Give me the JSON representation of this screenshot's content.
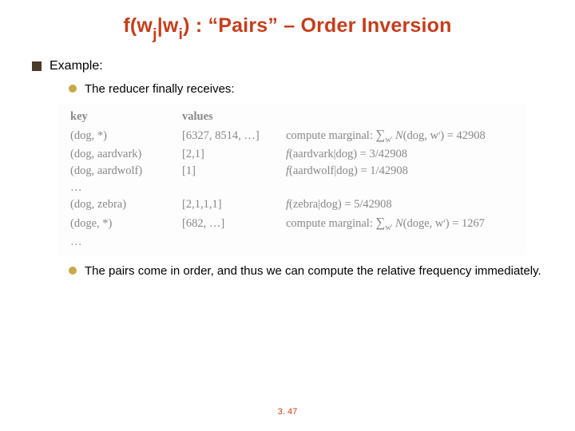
{
  "title": {
    "fw": "f(w",
    "j": "j",
    "bar_w": "|w",
    "i": "i",
    "rest": ") : “Pairs” – Order Inversion"
  },
  "bullets": {
    "example": "Example:",
    "sub1": "The reducer finally receives:",
    "sub2": "The pairs come in order, and thus we can compute the relative frequency immediately."
  },
  "table": {
    "headers": {
      "key": "key",
      "values": "values"
    },
    "rows": [
      {
        "key": "(dog, *)",
        "values": "[6327, 8514, …]",
        "comp": "compute marginal: ∑_{w'} N(dog, w') = 42908"
      },
      {
        "key": "(dog, aardvark)",
        "values": "[2,1]",
        "comp": "f(aardvark|dog) = 3/42908"
      },
      {
        "key": "(dog, aardwolf)",
        "values": "[1]",
        "comp": "f(aardwolf|dog) = 1/42908"
      },
      {
        "key": "…",
        "values": "",
        "comp": ""
      },
      {
        "key": "(dog, zebra)",
        "values": "[2,1,1,1]",
        "comp": "f(zebra|dog) = 5/42908"
      },
      {
        "key": "(doge, *)",
        "values": "[682, …]",
        "comp": "compute marginal: ∑_{w'} N(doge, w') = 1267"
      },
      {
        "key": "…",
        "values": "",
        "comp": ""
      }
    ]
  },
  "page": "3. 47"
}
